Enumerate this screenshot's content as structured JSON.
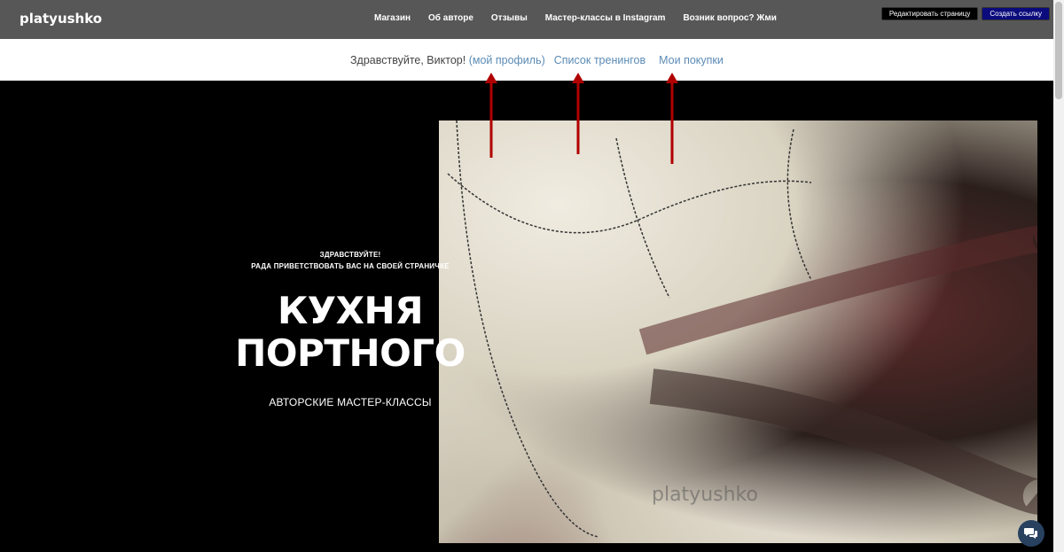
{
  "nav": {
    "brand": "platyushko",
    "items": [
      {
        "label": "Магазин"
      },
      {
        "label": "Об авторе"
      },
      {
        "label": "Отзывы"
      },
      {
        "label": "Мастер-классы в Instagram"
      },
      {
        "label": "Возник вопрос? Жми"
      }
    ],
    "edit_label": "Редактировать страницу",
    "create_link_label": "Создать ссылку"
  },
  "userbar": {
    "greeting": "Здравствуйте, Виктор!",
    "profile_link": "(мой профиль)",
    "trainings_link": "Список тренингов",
    "purchases_link": "Мои покупки"
  },
  "hero": {
    "hello_line1": "ЗДРАВСТВУЙТЕ!",
    "hello_line2": "РАДА ПРИВЕТСТВОВАТЬ ВАС НА СВОЕЙ СТРАНИЧКЕ",
    "title_line1": "КУХНЯ",
    "title_line2": "ПОРТНОГО",
    "subtitle": "АВТОРСКИЕ МАСТЕР-КЛАССЫ",
    "photo_watermark": "platyushko"
  },
  "colors": {
    "nav_bg": "#575757",
    "link_blue": "#5b8bb5",
    "arrow_red": "#b00000",
    "chat_bg": "#27415f"
  },
  "icons": {
    "chat": "chat-bubbles-icon",
    "arrow": "red-up-arrow-icon"
  }
}
